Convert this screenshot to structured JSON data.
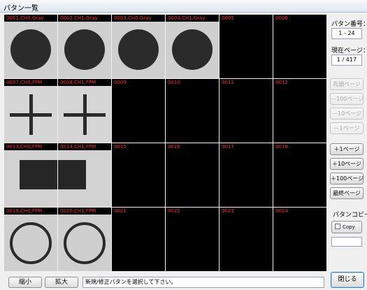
{
  "window": {
    "title": "パタン一覧"
  },
  "cells": [
    {
      "label": "0001,CH0,Gray",
      "type": "circle"
    },
    {
      "label": "0002,CH1,Gray",
      "type": "circle"
    },
    {
      "label": "0003,CH0,Gray",
      "type": "circle"
    },
    {
      "label": "0004,CH1,Gray",
      "type": "circle"
    },
    {
      "label": "0005",
      "type": "empty"
    },
    {
      "label": "0006",
      "type": "empty"
    },
    {
      "label": "0007,CH0,FPM",
      "type": "cross"
    },
    {
      "label": "0008,CH1,FPM",
      "type": "cross"
    },
    {
      "label": "0009",
      "type": "empty"
    },
    {
      "label": "0010",
      "type": "empty"
    },
    {
      "label": "0011",
      "type": "empty"
    },
    {
      "label": "0012",
      "type": "empty"
    },
    {
      "label": "0013,CH0,FPM",
      "type": "square-left"
    },
    {
      "label": "0014,CH1,FPM",
      "type": "square-right"
    },
    {
      "label": "0015",
      "type": "empty"
    },
    {
      "label": "0016",
      "type": "empty"
    },
    {
      "label": "0017",
      "type": "empty"
    },
    {
      "label": "0018",
      "type": "empty"
    },
    {
      "label": "0019,CH0,FPM",
      "type": "ring"
    },
    {
      "label": "0020,CH1,FPM",
      "type": "ring"
    },
    {
      "label": "0021",
      "type": "empty"
    },
    {
      "label": "0022",
      "type": "empty"
    },
    {
      "label": "0023",
      "type": "empty"
    },
    {
      "label": "0024",
      "type": "empty"
    }
  ],
  "sidebar": {
    "pattern_number_label": "パタン番号：",
    "pattern_number_value": "1 - 24",
    "current_page_label": "現在ページ：",
    "current_page_value": "1 / 417",
    "nav_buttons": [
      {
        "label": "先頭ページ",
        "enabled": false
      },
      {
        "label": "－100ページ",
        "enabled": false
      },
      {
        "label": "－10ページ",
        "enabled": false
      },
      {
        "label": "－1ページ",
        "enabled": false
      },
      {
        "label": "＋1ページ",
        "enabled": true
      },
      {
        "label": "＋10ページ",
        "enabled": true
      },
      {
        "label": "＋100ページ",
        "enabled": true
      },
      {
        "label": "最終ページ",
        "enabled": true
      }
    ],
    "pattern_copy_label": "パタンコピー",
    "copy_checkbox_label": "Copy",
    "copy_checked": false
  },
  "footer": {
    "shrink_label": "縮小",
    "enlarge_label": "拡大",
    "status_text": "新規/修正パタンを選択して下さい。",
    "close_label": "閉じる"
  },
  "colors": {
    "cell_label": "#ff2a2a",
    "cell_bg": "#000000"
  }
}
